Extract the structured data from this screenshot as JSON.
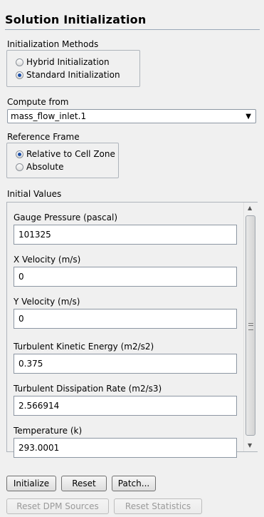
{
  "panel": {
    "title": "Solution Initialization"
  },
  "init_methods": {
    "label": "Initialization Methods",
    "options": [
      "Hybrid  Initialization",
      "Standard Initialization"
    ],
    "selected": 1
  },
  "compute_from": {
    "label": "Compute from",
    "value": "mass_flow_inlet.1"
  },
  "reference_frame": {
    "label": "Reference Frame",
    "options": [
      "Relative to Cell Zone",
      "Absolute"
    ],
    "selected": 0
  },
  "initial_values": {
    "label": "Initial Values",
    "fields": [
      {
        "label": "Gauge Pressure (pascal)",
        "value": "101325"
      },
      {
        "label": "X Velocity (m/s)",
        "value": "0"
      },
      {
        "label": "Y Velocity (m/s)",
        "value": "0"
      },
      {
        "label": "Turbulent Kinetic Energy (m2/s2)",
        "value": "0.375"
      },
      {
        "label": "Turbulent Dissipation Rate (m2/s3)",
        "value": "2.566914"
      },
      {
        "label": "Temperature (k)",
        "value": "293.0001"
      }
    ]
  },
  "buttons": {
    "initialize": "Initialize",
    "reset": "Reset",
    "patch": "Patch...",
    "reset_dpm": "Reset DPM Sources",
    "reset_stats": "Reset Statistics"
  }
}
